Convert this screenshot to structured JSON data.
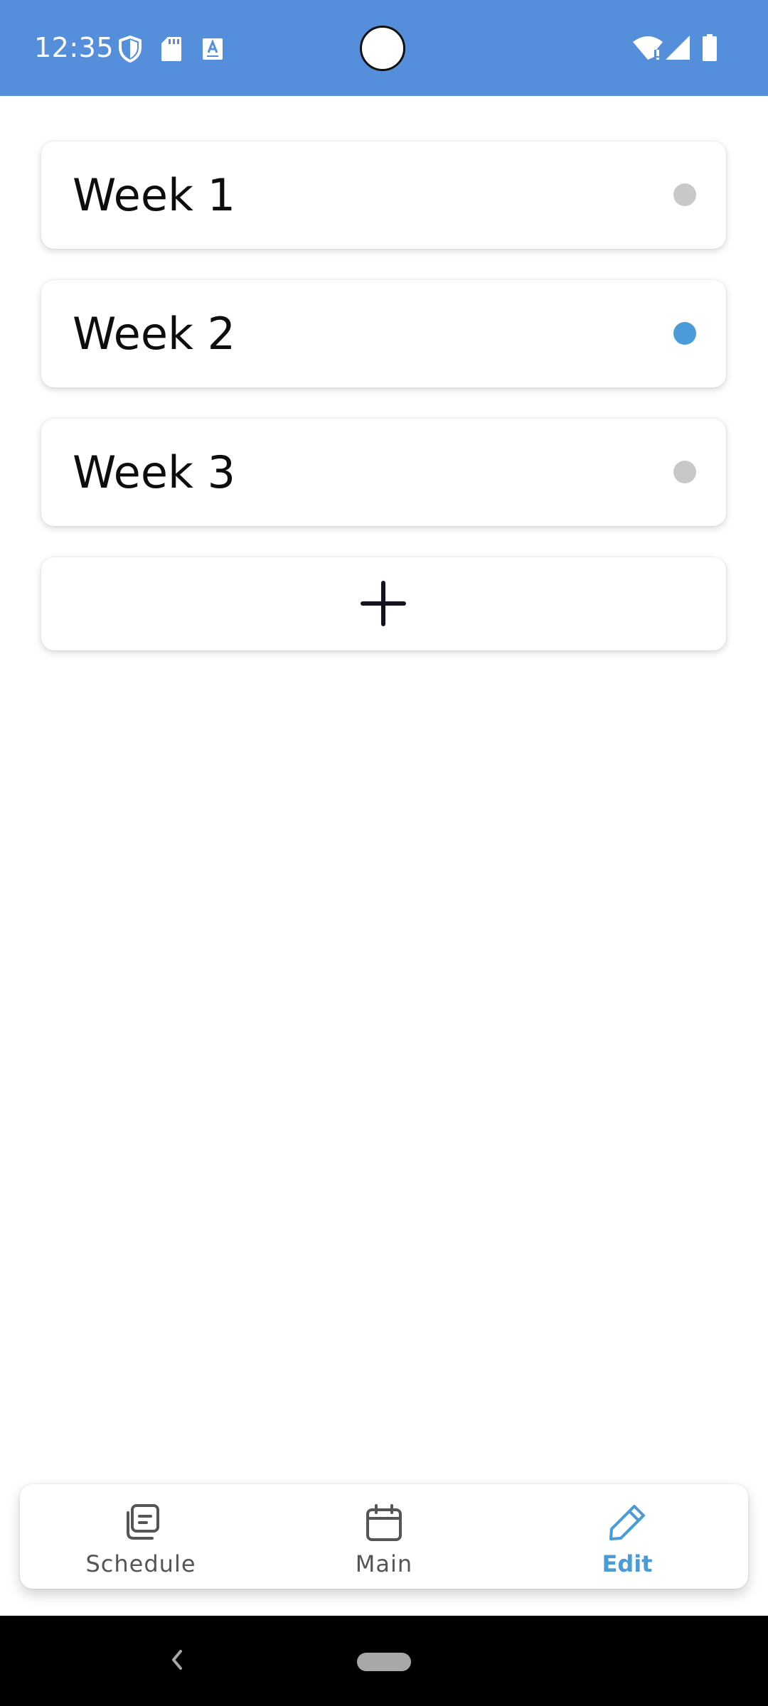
{
  "status_bar": {
    "time": "12:35",
    "background_color": "#558fdb",
    "left_icons": [
      "shield-icon",
      "sd-card-icon",
      "keyboard-icon"
    ],
    "right_icons": [
      "wifi-alert-icon",
      "signal-icon",
      "battery-icon"
    ]
  },
  "weeks": [
    {
      "label": "Week 1",
      "status_color": "#c8c8c8",
      "selected": false
    },
    {
      "label": "Week 2",
      "status_color": "#4a9bd8",
      "selected": true
    },
    {
      "label": "Week 3",
      "status_color": "#c8c8c8",
      "selected": false
    }
  ],
  "add_button": {
    "icon": "plus-icon"
  },
  "bottom_nav": {
    "items": [
      {
        "label": "Schedule",
        "icon": "schedule-icon",
        "active": false
      },
      {
        "label": "Main",
        "icon": "calendar-icon",
        "active": false
      },
      {
        "label": "Edit",
        "icon": "pencil-icon",
        "active": true
      }
    ],
    "active_color": "#4a9bd8",
    "inactive_color": "#555555"
  },
  "system_nav": {
    "icons": [
      "back-icon",
      "home-pill-icon"
    ]
  }
}
